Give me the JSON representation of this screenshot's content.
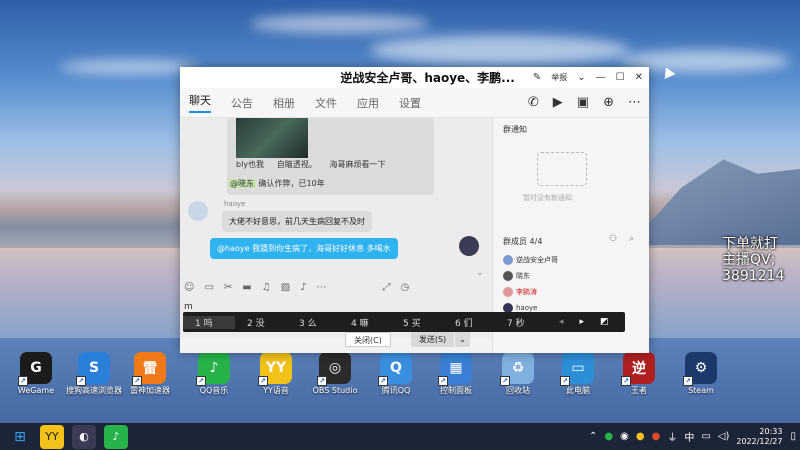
{
  "window": {
    "title": "逆战安全卢哥、haoye、李鹏...",
    "report": "举报"
  },
  "tabs": [
    {
      "label": "聊天"
    },
    {
      "label": "公告"
    },
    {
      "label": "相册"
    },
    {
      "label": "文件"
    },
    {
      "label": "应用"
    },
    {
      "label": "设置"
    }
  ],
  "messages": {
    "image_caption": "bly也我     自瞄透视。     海哥麻烦看一下",
    "confirm_mention": "@晓东",
    "confirm_text": "确认作弊，已10年",
    "haoye_name": "haoye",
    "haoye_text": "大佬不好意思，前几天生病回复不及时",
    "my_text": "@haoye 我猜到你生病了，海哥好好休息  多喝水"
  },
  "input": {
    "text": "m"
  },
  "candidates": [
    "1 吗",
    "2 没",
    "3 么",
    "4 嘛",
    "5 买",
    "6 们",
    "7 秒"
  ],
  "buttons": {
    "close": "关闭(C)",
    "send": "发送(S)"
  },
  "notice": {
    "title": "群通知",
    "empty": "暂时没有新通知"
  },
  "members": {
    "title": "群成员 4/4",
    "list": [
      "逆战安全卢哥",
      "晓东",
      "李鹏涛",
      "haoye"
    ]
  },
  "desktop_icons": [
    {
      "label": "WeGame",
      "color": "#1b1b1b",
      "glyph": "G"
    },
    {
      "label": "搜狗高速浏览器",
      "color": "#2a7fd8",
      "glyph": "S"
    },
    {
      "label": "雷神加速器",
      "color": "#f07a1a",
      "glyph": "雷"
    },
    {
      "label": "QQ音乐",
      "color": "#27b34a",
      "glyph": "♪"
    },
    {
      "label": "YY语音",
      "color": "#f2c21a",
      "glyph": "YY"
    },
    {
      "label": "OBS Studio",
      "color": "#2b2b2b",
      "glyph": "◎"
    },
    {
      "label": "腾讯QQ",
      "color": "#3b8fe0",
      "glyph": "Q"
    },
    {
      "label": "控制面板",
      "color": "#3a7fd5",
      "glyph": "▦"
    },
    {
      "label": "回收站",
      "color": "#7fb0e0",
      "glyph": "♻"
    },
    {
      "label": "此电脑",
      "color": "#2d8ed8",
      "glyph": "▭"
    },
    {
      "label": "王者",
      "color": "#b02020",
      "glyph": "逆"
    },
    {
      "label": "Steam",
      "color": "#1b3a6b",
      "glyph": "⚙"
    }
  ],
  "overlay_text": [
    "下单就打",
    "主播QV;",
    "3891214"
  ],
  "taskbar": {
    "input_lang": "中",
    "time": "20:33",
    "date": "2022/12/27"
  }
}
